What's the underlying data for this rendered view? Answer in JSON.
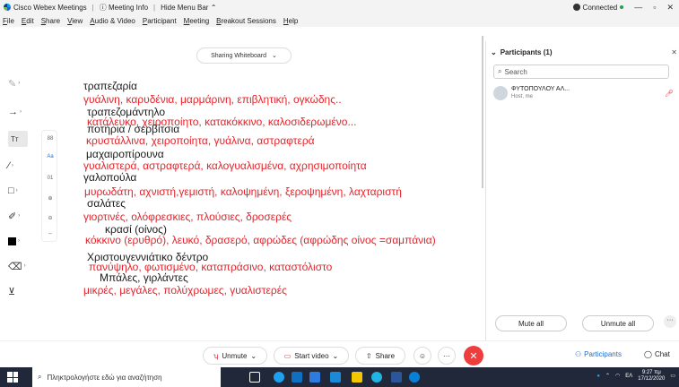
{
  "titlebar": {
    "app_name": "Cisco Webex Meetings",
    "meeting_info": "Meeting Info",
    "hide_menu": "Hide Menu Bar",
    "connection": "Connected"
  },
  "menubar": {
    "items": [
      {
        "label": "File",
        "key": "F"
      },
      {
        "label": "Edit",
        "key": "E"
      },
      {
        "label": "Share",
        "key": "S"
      },
      {
        "label": "View",
        "key": "V"
      },
      {
        "label": "Audio & Video",
        "key": "A"
      },
      {
        "label": "Participant",
        "key": "P"
      },
      {
        "label": "Meeting",
        "key": "M"
      },
      {
        "label": "Breakout Sessions",
        "key": "B"
      },
      {
        "label": "Help",
        "key": "H"
      }
    ]
  },
  "share": {
    "label": "Sharing Whiteboard"
  },
  "whiteboard": {
    "lines": [
      {
        "text": "τραπεζαρία",
        "color": "black"
      },
      {
        "text": "γυάλινη, καρυδένια, μαρμάρινη,  επιβλητική, ογκώδης..",
        "color": "red"
      },
      {
        "text": "τραπεζομάντηλο",
        "color": "black"
      },
      {
        "text": "κατάλευκο, χειροποίητο, κατακόκκινο, καλοσιδερωμένο...",
        "color": "red"
      },
      {
        "text": "ποτήρια    / σερβίτσια",
        "color": "black"
      },
      {
        "text": "κρυστάλλινα, χειροποίητα, γυάλινα, αστραφτερά",
        "color": "red"
      },
      {
        "text": "μαχαιροπίρουνα",
        "color": "black"
      },
      {
        "text": "γυαλιστερά, αστραφτερά, καλογυαλισμένα, αχρησιμοποίητα",
        "color": "red"
      },
      {
        "text": "γαλοπούλα",
        "color": "black"
      },
      {
        "text": "μυρωδάτη, αχνιστή,γεμιστή, καλοψημένη, ξεροψημένη, λαχταριστή",
        "color": "red"
      },
      {
        "text": "σαλάτες",
        "color": "black"
      },
      {
        "text": "γιορτινές, ολόφρεσκιες, πλούσιες, δροσερές",
        "color": "red"
      },
      {
        "text": "κρασί (οίνος)",
        "color": "black"
      },
      {
        "text": "κόκκινο (ερυθρό), λευκό, δρασερό, αφρώδες (αφρώδης οίνος =σαμπάνια)",
        "color": "red"
      },
      {
        "text": "Χριστουγεννιάτικο δέντρο",
        "color": "black"
      },
      {
        "text": "πανύψηλο, φωτισμένο, καταπράσινο, καταστόλιστο",
        "color": "red"
      },
      {
        "text": "Μπάλες, γιρλάντες",
        "color": "black"
      },
      {
        "text": "μικρές, μεγάλες, πολύχρωμες, γυαλιστερές",
        "color": "red"
      }
    ]
  },
  "subtools": [
    "88",
    "01"
  ],
  "participants": {
    "header": "Participants (1)",
    "search_placeholder": "Search",
    "list": [
      {
        "name": "ΦΥΤΟΠΟΥΛΟΥ ΑΛ...",
        "role": "Host, me"
      }
    ],
    "mute_all": "Mute all",
    "unmute_all": "Unmute all"
  },
  "controls": {
    "unmute": "Unmute",
    "start_video": "Start video",
    "share": "Share",
    "participants_tab": "Participants",
    "chat_tab": "Chat"
  },
  "taskbar": {
    "search_placeholder": "Πληκτρολογήστε εδώ για αναζήτηση",
    "lang": "ΕΛ",
    "time": "9:27 πμ",
    "date": "17/12/2020"
  },
  "icons": [
    "webex-logo-icon",
    "info-icon",
    "chevron-up-icon",
    "pen-icon",
    "arrow-pointer-icon",
    "text-icon",
    "line-icon",
    "rectangle-icon",
    "brush-icon",
    "color-square-icon",
    "eraser-icon",
    "save-icon",
    "search-icon",
    "microphone-muted-icon",
    "video-icon",
    "share-icon",
    "emoji-icon",
    "more-icon",
    "end-call-icon",
    "participants-icon",
    "chat-icon"
  ],
  "colors": {
    "red_text": "#e3242b",
    "accent_blue": "#1c6dd0",
    "end_call": "#ef3c3c",
    "taskbar": "#20283a"
  }
}
